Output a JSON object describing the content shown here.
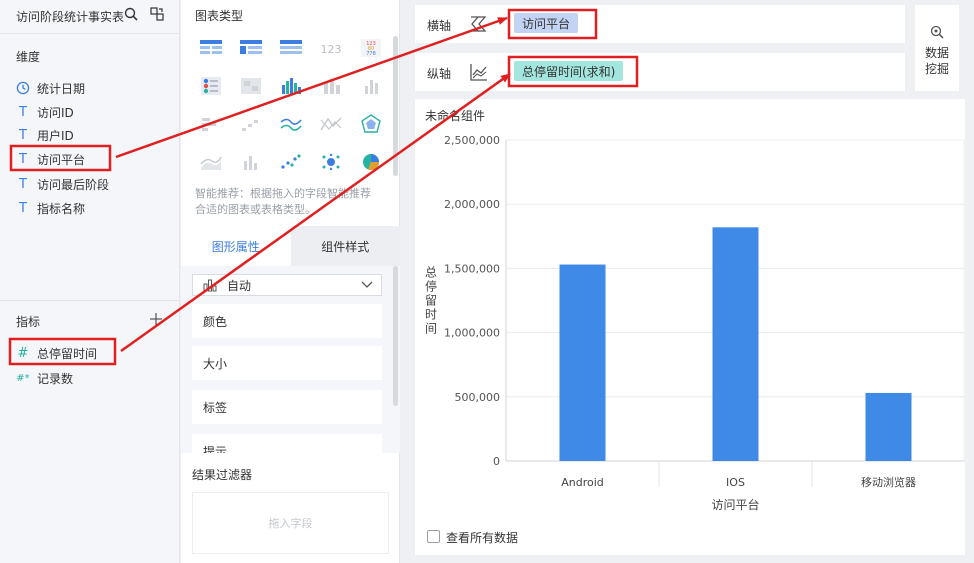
{
  "dataset": {
    "title": "访问阶段统计事实表",
    "dimension_title": "维度",
    "dimensions": [
      {
        "type": "clock-icon",
        "label": "统计日期"
      },
      {
        "type": "text-type-icon",
        "label": "访问ID"
      },
      {
        "type": "text-type-icon",
        "label": "用户ID"
      },
      {
        "type": "text-type-icon",
        "label": "访问平台"
      },
      {
        "type": "text-type-icon",
        "label": "访问最后阶段"
      },
      {
        "type": "text-type-icon",
        "label": "指标名称"
      }
    ],
    "measure_title": "指标",
    "measures": [
      {
        "type": "#",
        "label": "总停留时间"
      },
      {
        "type": "#*",
        "label": "记录数"
      }
    ]
  },
  "chart_panel": {
    "title": "图表类型",
    "smart_tip": "智能推荐：根据拖入的字段智能推荐合适的图表或表格类型。",
    "tabs": [
      "图形属性",
      "组件样式"
    ],
    "auto_label": "自动",
    "props": [
      "颜色",
      "大小",
      "标签",
      "提示"
    ],
    "filter_title": "结果过滤器",
    "filter_placeholder": "拖入字段"
  },
  "shelves": {
    "x_label": "横轴",
    "x_field": "访问平台",
    "y_label": "纵轴",
    "y_field": "总停留时间(求和)"
  },
  "mining": {
    "line1": "数据",
    "line2": "挖掘"
  },
  "component": {
    "title": "未命名组件",
    "show_all_label": "查看所有数据"
  },
  "colors": {
    "accent": "#3b7ee0",
    "bar": "#3f8ae6",
    "x_pill": "#c2d3f3",
    "y_pill": "#a3e6df",
    "annotation": "#e02020"
  },
  "chart_data": {
    "type": "bar",
    "categories": [
      "Android",
      "IOS",
      "移动浏览器"
    ],
    "series": [
      {
        "values": [
          1530000,
          1820000,
          530000
        ]
      }
    ],
    "xlabel": "访问平台",
    "ylabel": "总停留时间",
    "yticks": [
      "0",
      "500,000",
      "1,000,000",
      "1,500,000",
      "2,000,000",
      "2,500,000"
    ],
    "ylim": [
      0,
      2500000
    ],
    "grid": true
  }
}
